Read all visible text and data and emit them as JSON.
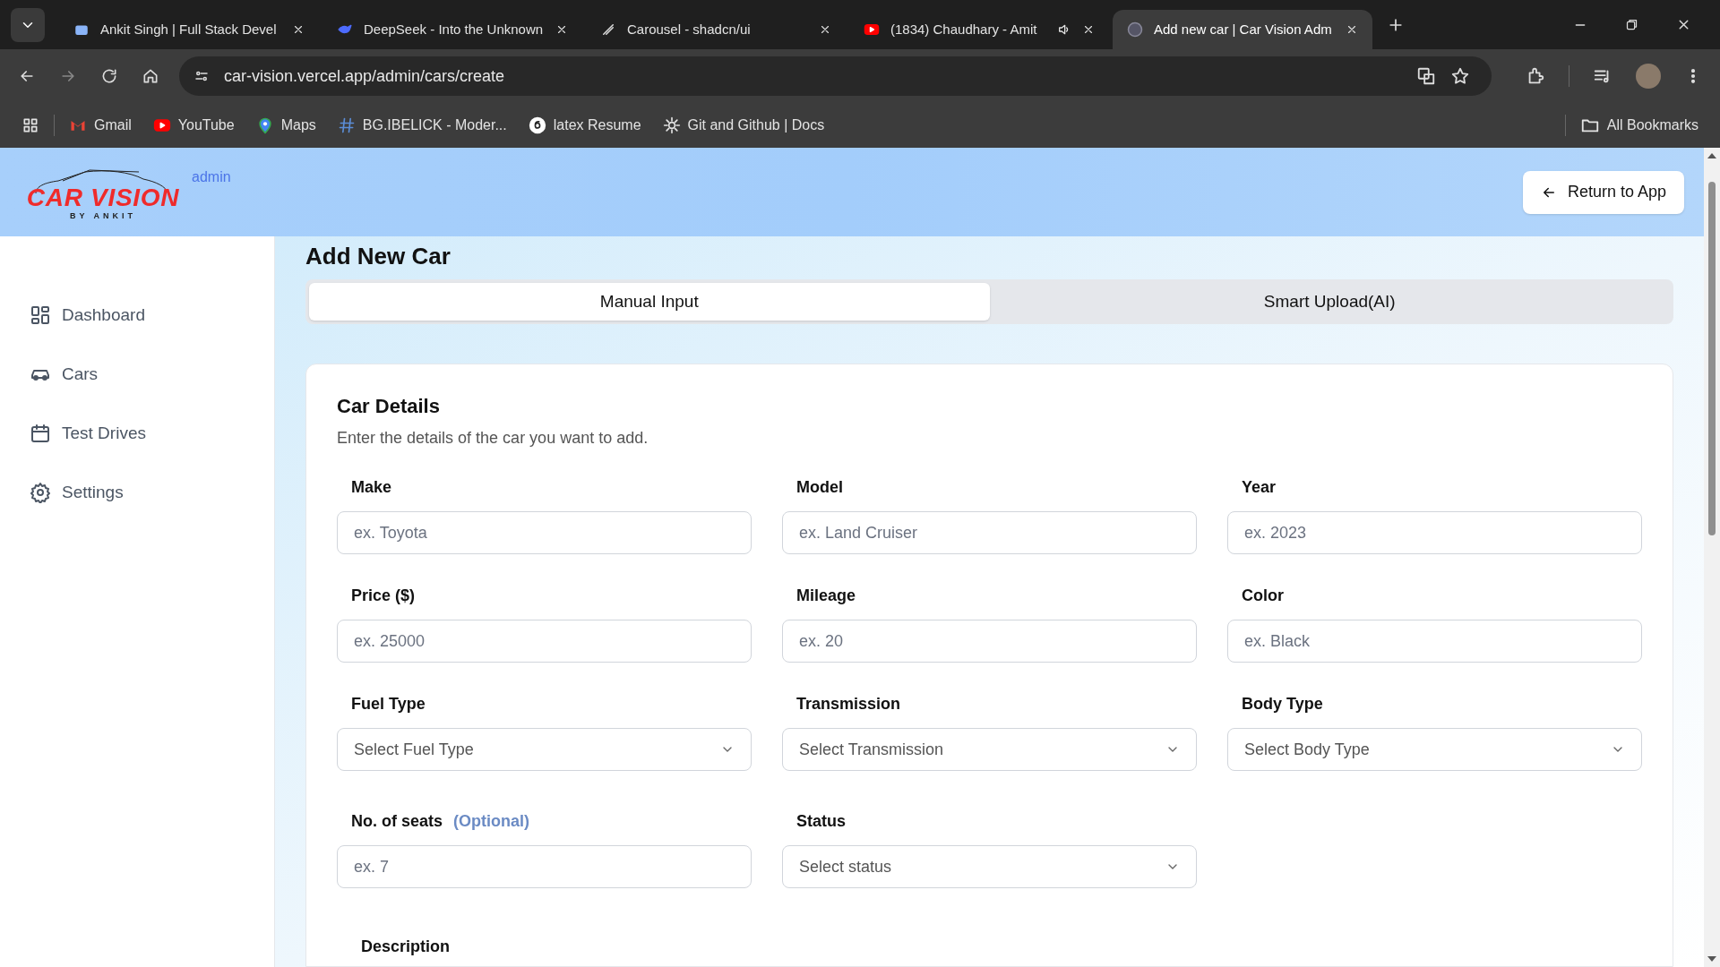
{
  "browser": {
    "tabs": [
      {
        "title": "Ankit Singh | Full Stack Devel",
        "selected": false,
        "audible": false
      },
      {
        "title": "DeepSeek - Into the Unknown",
        "selected": false,
        "audible": false
      },
      {
        "title": "Carousel - shadcn/ui",
        "selected": false,
        "audible": false
      },
      {
        "title": "(1834) Chaudhary - Amit",
        "selected": false,
        "audible": true
      },
      {
        "title": "Add new car | Car Vision Adm",
        "selected": true,
        "audible": false
      }
    ],
    "address": "car-vision.vercel.app/admin/cars/create",
    "bookmarks": [
      "Gmail",
      "YouTube",
      "Maps",
      "BG.IBELICK - Moder...",
      "latex Resume",
      "Git and Github | Docs"
    ],
    "all_bookmarks": "All Bookmarks"
  },
  "header": {
    "logo_title": "CAR VISION",
    "logo_subtitle": "BY ANKIT",
    "badge": "admin",
    "return_button": "Return to App"
  },
  "sidebar": {
    "items": [
      {
        "label": "Dashboard",
        "selected": false
      },
      {
        "label": "Cars",
        "selected": false
      },
      {
        "label": "Test Drives",
        "selected": false
      },
      {
        "label": "Settings",
        "selected": false
      }
    ]
  },
  "page_title": "Add New Car",
  "mode_tabs": [
    {
      "label": "Manual Input",
      "selected": true
    },
    {
      "label": "Smart Upload(AI)",
      "selected": false
    }
  ],
  "card": {
    "title": "Car Details",
    "subtitle": "Enter the details of the car you want to add.",
    "fields": [
      {
        "kind": "text",
        "label": "Make",
        "placeholder": "ex. Toyota"
      },
      {
        "kind": "text",
        "label": "Model",
        "placeholder": "ex. Land Cruiser"
      },
      {
        "kind": "text",
        "label": "Year",
        "placeholder": "ex. 2023"
      },
      {
        "kind": "text",
        "label": "Price ($)",
        "placeholder": "ex. 25000"
      },
      {
        "kind": "text",
        "label": "Mileage",
        "placeholder": "ex. 20"
      },
      {
        "kind": "text",
        "label": "Color",
        "placeholder": "ex. Black"
      },
      {
        "kind": "select",
        "label": "Fuel Type",
        "placeholder": "Select Fuel Type"
      },
      {
        "kind": "select",
        "label": "Transmission",
        "placeholder": "Select Transmission"
      },
      {
        "kind": "select",
        "label": "Body Type",
        "placeholder": "Select Body Type"
      },
      {
        "kind": "text",
        "label": "No. of seats",
        "optional": "(Optional)",
        "placeholder": "ex. 7"
      },
      {
        "kind": "select",
        "label": "Status",
        "placeholder": "Select status"
      }
    ],
    "description_label": "Description"
  }
}
